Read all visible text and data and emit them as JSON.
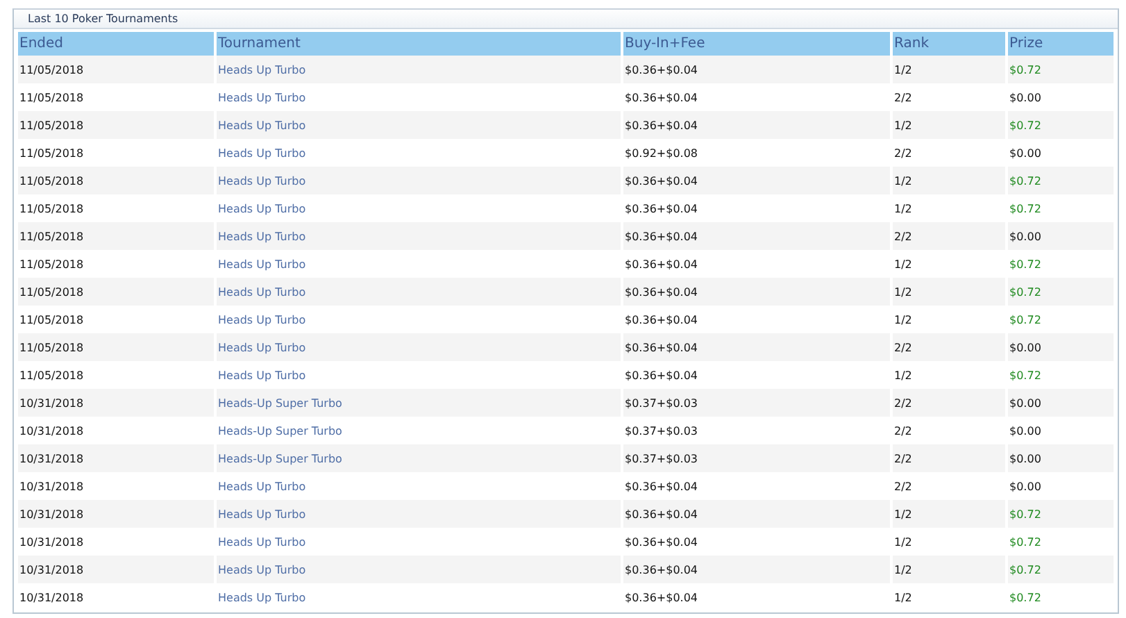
{
  "panel": {
    "title": "Last 10 Poker Tournaments"
  },
  "table": {
    "columns": [
      "Ended",
      "Tournament",
      "Buy-In+Fee",
      "Rank",
      "Prize"
    ],
    "rows": [
      {
        "ended": "11/05/2018",
        "tournament": "Heads Up Turbo",
        "buy_in": "$0.36+$0.04",
        "rank": "1/2",
        "prize": "$0.72",
        "won": true
      },
      {
        "ended": "11/05/2018",
        "tournament": "Heads Up Turbo",
        "buy_in": "$0.36+$0.04",
        "rank": "2/2",
        "prize": "$0.00",
        "won": false
      },
      {
        "ended": "11/05/2018",
        "tournament": "Heads Up Turbo",
        "buy_in": "$0.36+$0.04",
        "rank": "1/2",
        "prize": "$0.72",
        "won": true
      },
      {
        "ended": "11/05/2018",
        "tournament": "Heads Up Turbo",
        "buy_in": "$0.92+$0.08",
        "rank": "2/2",
        "prize": "$0.00",
        "won": false
      },
      {
        "ended": "11/05/2018",
        "tournament": "Heads Up Turbo",
        "buy_in": "$0.36+$0.04",
        "rank": "1/2",
        "prize": "$0.72",
        "won": true
      },
      {
        "ended": "11/05/2018",
        "tournament": "Heads Up Turbo",
        "buy_in": "$0.36+$0.04",
        "rank": "1/2",
        "prize": "$0.72",
        "won": true
      },
      {
        "ended": "11/05/2018",
        "tournament": "Heads Up Turbo",
        "buy_in": "$0.36+$0.04",
        "rank": "2/2",
        "prize": "$0.00",
        "won": false
      },
      {
        "ended": "11/05/2018",
        "tournament": "Heads Up Turbo",
        "buy_in": "$0.36+$0.04",
        "rank": "1/2",
        "prize": "$0.72",
        "won": true
      },
      {
        "ended": "11/05/2018",
        "tournament": "Heads Up Turbo",
        "buy_in": "$0.36+$0.04",
        "rank": "1/2",
        "prize": "$0.72",
        "won": true
      },
      {
        "ended": "11/05/2018",
        "tournament": "Heads Up Turbo",
        "buy_in": "$0.36+$0.04",
        "rank": "1/2",
        "prize": "$0.72",
        "won": true
      },
      {
        "ended": "11/05/2018",
        "tournament": "Heads Up Turbo",
        "buy_in": "$0.36+$0.04",
        "rank": "2/2",
        "prize": "$0.00",
        "won": false
      },
      {
        "ended": "11/05/2018",
        "tournament": "Heads Up Turbo",
        "buy_in": "$0.36+$0.04",
        "rank": "1/2",
        "prize": "$0.72",
        "won": true
      },
      {
        "ended": "10/31/2018",
        "tournament": "Heads-Up Super Turbo",
        "buy_in": "$0.37+$0.03",
        "rank": "2/2",
        "prize": "$0.00",
        "won": false
      },
      {
        "ended": "10/31/2018",
        "tournament": "Heads-Up Super Turbo",
        "buy_in": "$0.37+$0.03",
        "rank": "2/2",
        "prize": "$0.00",
        "won": false
      },
      {
        "ended": "10/31/2018",
        "tournament": "Heads-Up Super Turbo",
        "buy_in": "$0.37+$0.03",
        "rank": "2/2",
        "prize": "$0.00",
        "won": false
      },
      {
        "ended": "10/31/2018",
        "tournament": "Heads Up Turbo",
        "buy_in": "$0.36+$0.04",
        "rank": "2/2",
        "prize": "$0.00",
        "won": false
      },
      {
        "ended": "10/31/2018",
        "tournament": "Heads Up Turbo",
        "buy_in": "$0.36+$0.04",
        "rank": "1/2",
        "prize": "$0.72",
        "won": true
      },
      {
        "ended": "10/31/2018",
        "tournament": "Heads Up Turbo",
        "buy_in": "$0.36+$0.04",
        "rank": "1/2",
        "prize": "$0.72",
        "won": true
      },
      {
        "ended": "10/31/2018",
        "tournament": "Heads Up Turbo",
        "buy_in": "$0.36+$0.04",
        "rank": "1/2",
        "prize": "$0.72",
        "won": true
      },
      {
        "ended": "10/31/2018",
        "tournament": "Heads Up Turbo",
        "buy_in": "$0.36+$0.04",
        "rank": "1/2",
        "prize": "$0.72",
        "won": true
      }
    ]
  }
}
